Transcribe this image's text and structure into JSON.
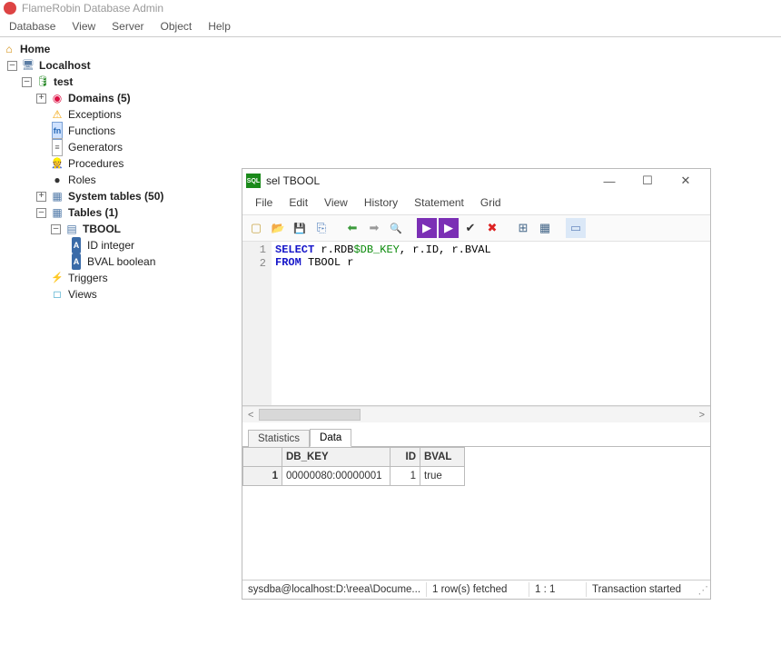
{
  "app": {
    "title": "FlameRobin Database Admin"
  },
  "main_menu": [
    "Database",
    "View",
    "Server",
    "Object",
    "Help"
  ],
  "tree": {
    "home": "Home",
    "server": "Localhost",
    "db": "test",
    "items": {
      "domains": "Domains (5)",
      "exceptions": "Exceptions",
      "functions": "Functions",
      "generators": "Generators",
      "procedures": "Procedures",
      "roles": "Roles",
      "systables": "System tables (50)",
      "tables": "Tables (1)",
      "tbool": "TBOOL",
      "col_id": "ID integer",
      "col_bval": "BVAL boolean",
      "triggers": "Triggers",
      "views": "Views"
    }
  },
  "sqlwin": {
    "title": "sel TBOOL",
    "menu": [
      "File",
      "Edit",
      "View",
      "History",
      "Statement",
      "Grid"
    ],
    "editor": {
      "line1": {
        "kw1": "SELECT",
        "p1": " r.RDB",
        "var": "$DB_KEY",
        "p2": ", r.ID, r.BVAL"
      },
      "line2": {
        "kw1": "FROM",
        "p1": " TBOOL r"
      },
      "line_numbers": [
        "1",
        "2"
      ]
    },
    "tabs": {
      "stats": "Statistics",
      "data": "Data"
    },
    "grid": {
      "columns": [
        "DB_KEY",
        "ID",
        "BVAL"
      ],
      "rows": [
        {
          "n": "1",
          "db_key": "00000080:00000001",
          "id": "1",
          "bval": "true"
        }
      ]
    },
    "status": {
      "conn": "sysdba@localhost:D:\\reea\\Docume...",
      "rows": "1 row(s) fetched",
      "pos": "1 : 1",
      "tx": "Transaction started"
    }
  }
}
